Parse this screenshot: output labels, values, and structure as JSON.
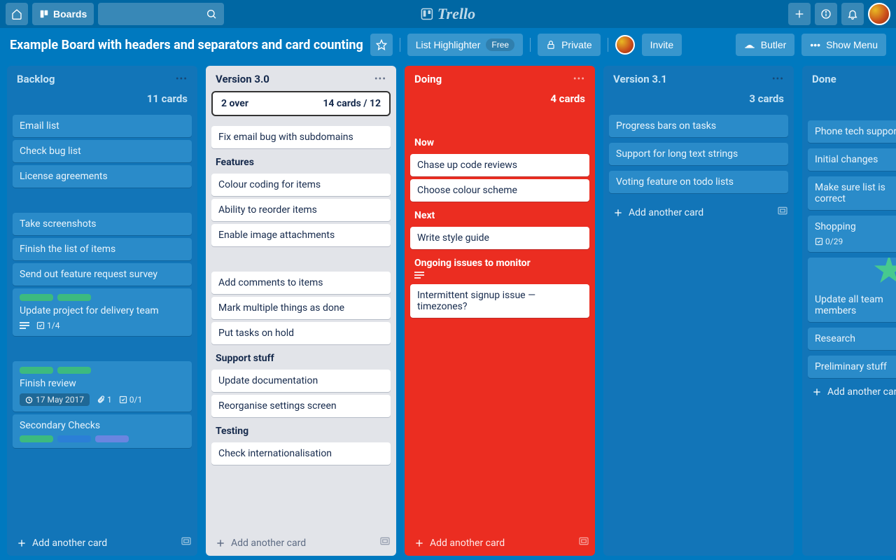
{
  "topbar": {
    "boards_label": "Boards",
    "logo_text": "Trello"
  },
  "board": {
    "title": "Example Board with headers and separators and card counting",
    "highlighter_label": "List Highlighter",
    "highlighter_badge": "Free",
    "privacy_label": "Private",
    "invite_label": "Invite",
    "butler_label": "Butler",
    "show_menu_label": "Show Menu"
  },
  "lists": {
    "backlog": {
      "title": "Backlog",
      "count": "11 cards",
      "cards_a": [
        "Email list",
        "Check bug list",
        "License agreements"
      ],
      "cards_b": [
        "Take screenshots",
        "Finish the list of items",
        "Send out feature request survey"
      ],
      "card_update": {
        "text": "Update project for delivery team",
        "check": "1/4"
      },
      "card_review": {
        "text": "Finish review",
        "date": "17 May 2017",
        "attach": "1",
        "check": "0/1"
      },
      "card_secondary": {
        "text": "Secondary Checks"
      },
      "add": "Add another card"
    },
    "v30": {
      "title": "Version 3.0",
      "over_text": "2 over",
      "count_text": "14 cards / 12",
      "card_first": "Fix email bug with subdomains",
      "sec_features": "Features",
      "features": [
        "Colour coding for items",
        "Ability to reorder items",
        "Enable image attachments"
      ],
      "block2": [
        "Add comments to items",
        "Mark multiple things as done",
        "Put tasks on hold"
      ],
      "sec_support": "Support stuff",
      "support": [
        "Update documentation",
        "Reorganise settings screen"
      ],
      "sec_testing": "Testing",
      "testing": [
        "Check internationalisation"
      ],
      "add": "Add another card"
    },
    "doing": {
      "title": "Doing",
      "count": "4 cards",
      "sec_now": "Now",
      "now": [
        "Chase up code reviews",
        "Choose colour scheme"
      ],
      "sec_next": "Next",
      "next": [
        "Write style guide"
      ],
      "sec_ongoing": "Ongoing issues to monitor",
      "ongoing": [
        "Intermittent signup issue — timezones?"
      ],
      "add": "Add another card"
    },
    "v31": {
      "title": "Version 3.1",
      "count": "3 cards",
      "cards": [
        "Progress bars on tasks",
        "Support for long text strings",
        "Voting feature on todo lists"
      ],
      "add": "Add another card"
    },
    "done": {
      "title": "Done",
      "cards_a": [
        "Phone tech support",
        "Initial changes",
        "Make sure list is correct"
      ],
      "shopping": {
        "text": "Shopping",
        "check": "0/29"
      },
      "card_update": "Update all team members",
      "cards_b": [
        "Research",
        "Preliminary stuff"
      ],
      "add": "Add another card"
    }
  }
}
